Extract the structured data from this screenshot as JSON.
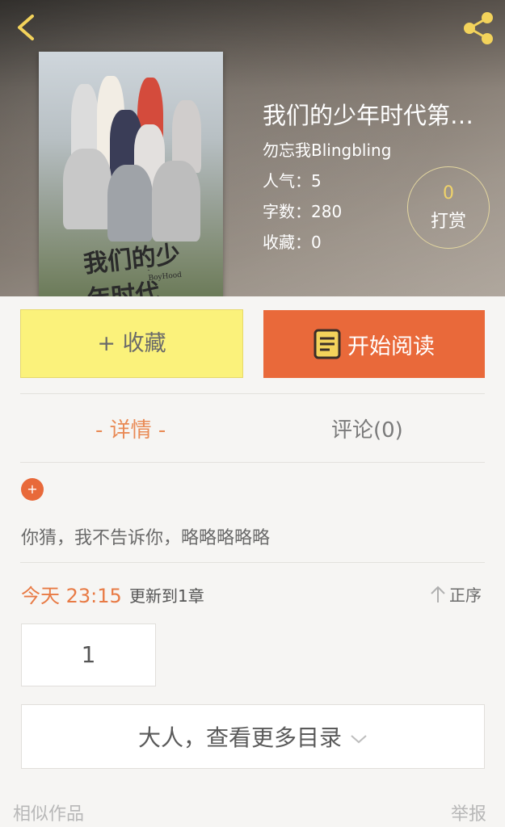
{
  "book": {
    "title": "我们的少年时代第…",
    "author": "勿忘我Blingbling",
    "stats": [
      {
        "label": "人气：",
        "value": "5"
      },
      {
        "label": "字数：",
        "value": "280"
      },
      {
        "label": "收藏：",
        "value": "0"
      }
    ],
    "cover_title_art": "我们的少年时代",
    "cover_subtitle": "-BoyHood"
  },
  "reward": {
    "count": "0",
    "label": "打赏"
  },
  "actions": {
    "collect_label": "+ 收藏",
    "read_label": "开始阅读"
  },
  "tabs": {
    "detail": "- 详情 -",
    "comments": "评论(0)"
  },
  "detail": {
    "expand_symbol": "+",
    "description": "你猜，我不告诉你，略略略略略"
  },
  "catalog": {
    "update_time": "今天 23:15",
    "update_text": "更新到1章",
    "sort_label": "正序",
    "chapters": [
      "1"
    ],
    "more_label": "大人，查看更多目录"
  },
  "footer": {
    "similar_label": "相似作品",
    "report_label": "举报"
  },
  "colors": {
    "accent": "#e9693a",
    "collect_bg": "#fbf27b",
    "reward_count": "#f0d36a",
    "active_tab": "#e98a55"
  },
  "icons": {
    "back": "chevron-left-icon",
    "share": "share-icon",
    "book": "book-icon",
    "sort": "arrow-up-icon",
    "expand": "chevron-down-icon"
  }
}
